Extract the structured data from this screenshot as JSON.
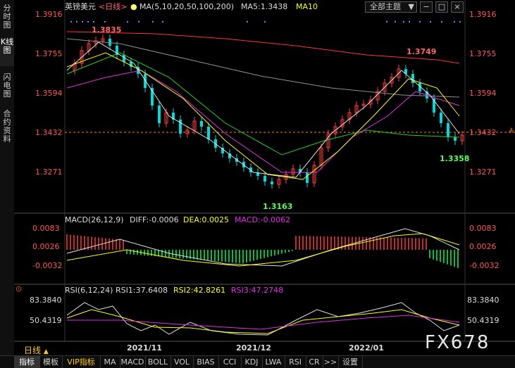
{
  "sidebar": {
    "tabs": [
      {
        "label": "分时图"
      },
      {
        "label": "K线图"
      },
      {
        "label": "闪电图"
      },
      {
        "label": "合约资料"
      }
    ]
  },
  "header": {
    "symbol": "英镑美元",
    "period": "<日线>",
    "ma_params": "MA(5,10,20,50,100,200)",
    "ma5_label": "MA5:1.3438",
    "ma10_label": "MA10",
    "theme_select": "全部主题",
    "theme_arrow": "▼"
  },
  "price_axis": [
    "1.3916",
    "1.3755",
    "1.3594",
    "1.3432",
    "1.3271"
  ],
  "price_annotations": {
    "high1": "1.3835",
    "high2": "1.3749",
    "low1": "1.3163",
    "low2": "1.3358"
  },
  "macd": {
    "title": "MACD(26,12,9)",
    "diff": "DIFF:-0.0006",
    "dea": "DEA:0.0025",
    "macd": "MACD:-0.0062",
    "axis": [
      "0.0083",
      "0.0026",
      "-0.0032"
    ]
  },
  "rsi": {
    "title": "RSI(6,12,24)",
    "rsi1": "RSI1:37.6408",
    "rsi2": "RSI2:42.8261",
    "rsi3": "RSI3:47.2748",
    "axis": [
      "83.3840",
      "50.4319"
    ]
  },
  "x_axis": [
    "2021/11",
    "2021/12",
    "2022/01"
  ],
  "period_label": "日线",
  "period_arrow": "▲",
  "bottom_tabs": [
    "指标",
    "模板",
    "VIP指标",
    "MA",
    "MACD",
    "BOLL",
    "VOL",
    "BIAS",
    "CCI",
    "KDJ",
    "LWA",
    "RSI",
    "CR",
    ">>",
    "设置"
  ],
  "watermark": "FX678",
  "colors": {
    "up": "#ff3b3b",
    "down": "#00d9d9",
    "ma_red": "#ff3333",
    "ma_white": "#e0e0e0",
    "ma_yellow": "#ffff00",
    "ma_magenta": "#e030e0",
    "ma_green": "#20d020",
    "ma_gray": "#909090"
  }
}
